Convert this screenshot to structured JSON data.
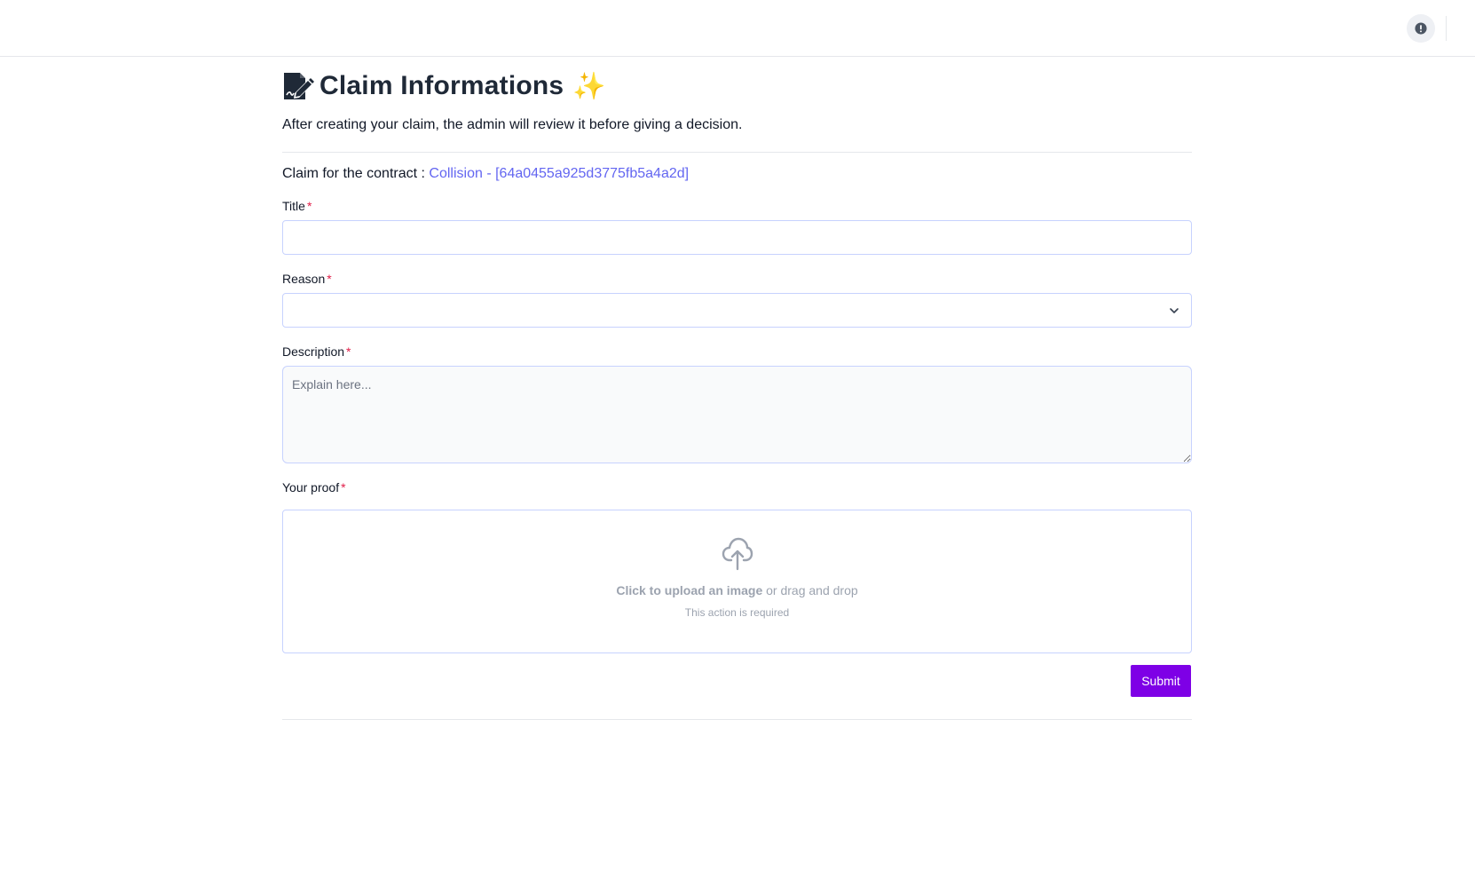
{
  "header": {
    "alert_icon": "exclamation-circle-icon"
  },
  "page": {
    "title": "Claim Informations",
    "title_emoji": "✨",
    "title_icon": "file-signature-icon",
    "subtitle": "After creating your claim, the admin will review it before giving a decision."
  },
  "contract": {
    "prefix": "Claim for the contract :",
    "link": "Collision - [64a0455a925d3775fb5a4a2d]"
  },
  "form": {
    "required_mark": "*",
    "title_label": "Title",
    "title_value": "",
    "reason_label": "Reason",
    "reason_value": "",
    "description_label": "Description",
    "description_placeholder": "Explain here...",
    "proof_label": "Your proof",
    "upload_cta": "Click to upload an image",
    "upload_hint": " or drag and drop",
    "upload_required": "This action is required",
    "submit_label": "Submit"
  },
  "colors": {
    "accent": "#7e00e6",
    "link": "#6366f1",
    "required": "#e11d48"
  }
}
